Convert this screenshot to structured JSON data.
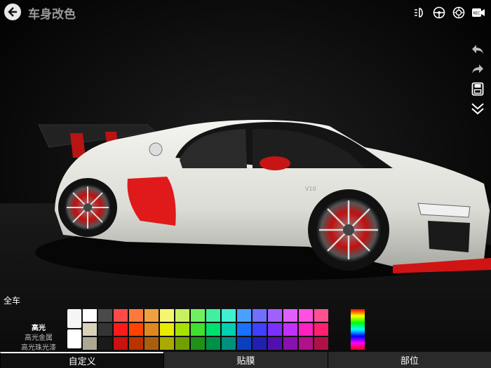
{
  "header": {
    "title": "车身改色"
  },
  "scope": {
    "label": "全车"
  },
  "finishes": [
    {
      "label": "高光",
      "active": true
    },
    {
      "label": "高光金属",
      "active": false
    },
    {
      "label": "高光珠光漆",
      "active": false
    }
  ],
  "car": {
    "badge": "V10"
  },
  "palette": {
    "neutrals_top": [
      "#f5f5f5",
      "#ffffff",
      "#4a4a4a"
    ],
    "neutrals_bottom": [
      "#d8d2b8",
      "#1a1a1a"
    ],
    "columns": [
      [
        "#ff4a4a",
        "#ff1a1a",
        "#cc1111"
      ],
      [
        "#ff7a3a",
        "#ff4400",
        "#b83300"
      ],
      [
        "#f0a040",
        "#e08820",
        "#a86010"
      ],
      [
        "#f5f570",
        "#eaea00",
        "#aaaa00"
      ],
      [
        "#c8f060",
        "#a8e000",
        "#70a000"
      ],
      [
        "#70f060",
        "#40e030",
        "#209018"
      ],
      [
        "#40f0a0",
        "#00e070",
        "#009048"
      ],
      [
        "#40f0d0",
        "#00d0b0",
        "#009080"
      ],
      [
        "#4aa0ff",
        "#1a70ff",
        "#0a40c0"
      ],
      [
        "#7070ff",
        "#4040ff",
        "#2020b0"
      ],
      [
        "#a060ff",
        "#7a30ff",
        "#5010b0"
      ],
      [
        "#e060ff",
        "#c030ff",
        "#8a10b0"
      ],
      [
        "#ff50e0",
        "#ff20c0",
        "#b01088"
      ],
      [
        "#ff5090",
        "#ff2070",
        "#b01048"
      ]
    ]
  },
  "tabs": [
    {
      "label": "自定义",
      "active": true
    },
    {
      "label": "贴膜",
      "active": false
    },
    {
      "label": "部位",
      "active": false
    }
  ],
  "colors": {
    "car_body": "#ebebe6",
    "accent_red": "#e01a1a"
  }
}
